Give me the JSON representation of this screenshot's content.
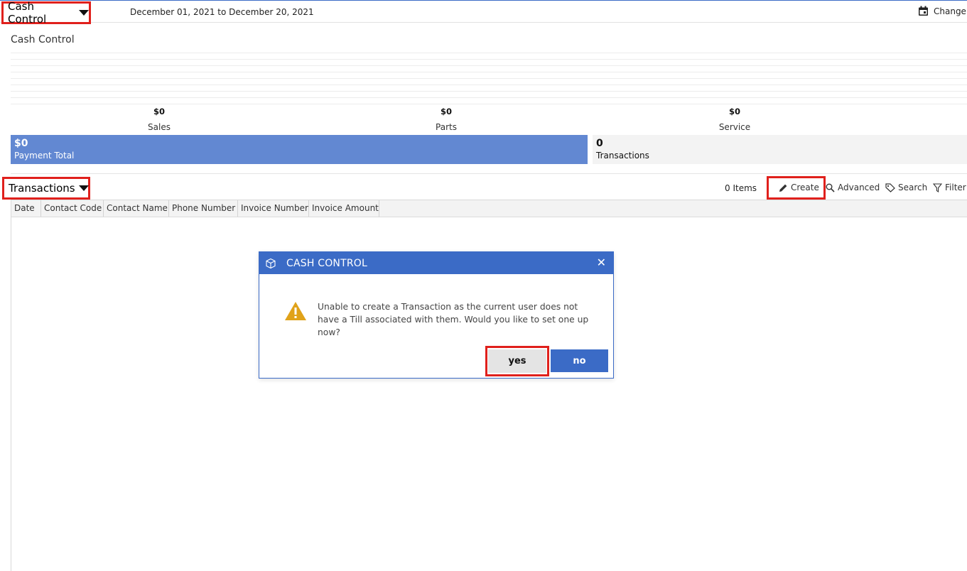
{
  "header": {
    "app_name": "Cash Control",
    "date_range": "December 01, 2021 to December 20, 2021",
    "change_label": "Change I"
  },
  "summary": {
    "title": "Cash Control",
    "stats": [
      {
        "amount": "$0",
        "label": "Sales"
      },
      {
        "amount": "$0",
        "label": "Parts"
      },
      {
        "amount": "$0",
        "label": "Service"
      }
    ],
    "payment_total": {
      "value": "$0",
      "label": "Payment Total"
    },
    "transactions": {
      "value": "0",
      "label": "Transactions"
    }
  },
  "transactions_section": {
    "title": "Transactions",
    "items_count": "0 Items",
    "toolbar": {
      "create": "Create",
      "advanced": "Advanced",
      "search": "Search",
      "filter": "Filter"
    },
    "columns": [
      "Date",
      "Contact Code",
      "Contact Name",
      "Phone Number",
      "Invoice Number",
      "Invoice Amount"
    ]
  },
  "dialog": {
    "title": "CASH CONTROL",
    "message": "Unable to create a Transaction as the current user does not have a Till associated with them. Would you like to set one up now?",
    "yes": "yes",
    "no": "no"
  },
  "colors": {
    "accent": "#3b6bc6",
    "payment_fill": "#6288d2",
    "highlight": "#e0201c",
    "warning": "#e0a21a"
  }
}
